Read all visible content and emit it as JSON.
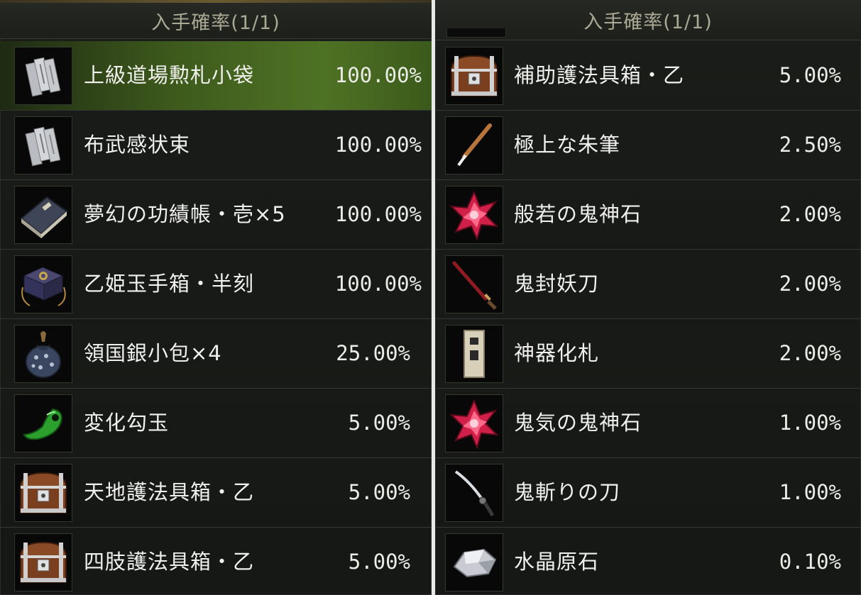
{
  "left": {
    "header": "入手確率(1/1)",
    "items": [
      {
        "name": "上級道場勲札小袋",
        "rate": "100.00%",
        "icon": "paper-talismans-icon",
        "selected": true
      },
      {
        "name": "布武感状束",
        "rate": "100.00%",
        "icon": "paper-talismans-icon",
        "selected": false
      },
      {
        "name": "夢幻の功績帳・壱×5",
        "rate": "100.00%",
        "icon": "ledger-book-icon",
        "selected": false
      },
      {
        "name": "乙姫玉手箱・半刻",
        "rate": "100.00%",
        "icon": "treasure-box-icon",
        "selected": false
      },
      {
        "name": "領国銀小包×4",
        "rate": "25.00%",
        "icon": "silver-pouch-icon",
        "selected": false
      },
      {
        "name": "変化勾玉",
        "rate": "5.00%",
        "icon": "magatama-icon",
        "selected": false
      },
      {
        "name": "天地護法具箱・乙",
        "rate": "5.00%",
        "icon": "chest-icon",
        "selected": false
      },
      {
        "name": "四肢護法具箱・乙",
        "rate": "5.00%",
        "icon": "chest-icon",
        "selected": false
      }
    ]
  },
  "right": {
    "header": "入手確率(1/1)",
    "items": [
      {
        "name": "補助護法具箱・乙",
        "rate": "5.00%",
        "icon": "chest-icon"
      },
      {
        "name": "極上な朱筆",
        "rate": "2.50%",
        "icon": "brush-icon"
      },
      {
        "name": "般若の鬼神石",
        "rate": "2.00%",
        "icon": "red-crystal-icon"
      },
      {
        "name": "鬼封妖刀",
        "rate": "2.00%",
        "icon": "katana-icon"
      },
      {
        "name": "神器化札",
        "rate": "2.00%",
        "icon": "wooden-tag-icon"
      },
      {
        "name": "鬼気の鬼神石",
        "rate": "1.00%",
        "icon": "red-crystal-icon"
      },
      {
        "name": "鬼斬りの刀",
        "rate": "1.00%",
        "icon": "blade-icon"
      },
      {
        "name": "水晶原石",
        "rate": "0.10%",
        "icon": "quartz-icon"
      }
    ]
  },
  "colors": {
    "selected_row": "#4e7224",
    "text": "#f0f0ec",
    "header_text": "#a9a994"
  }
}
